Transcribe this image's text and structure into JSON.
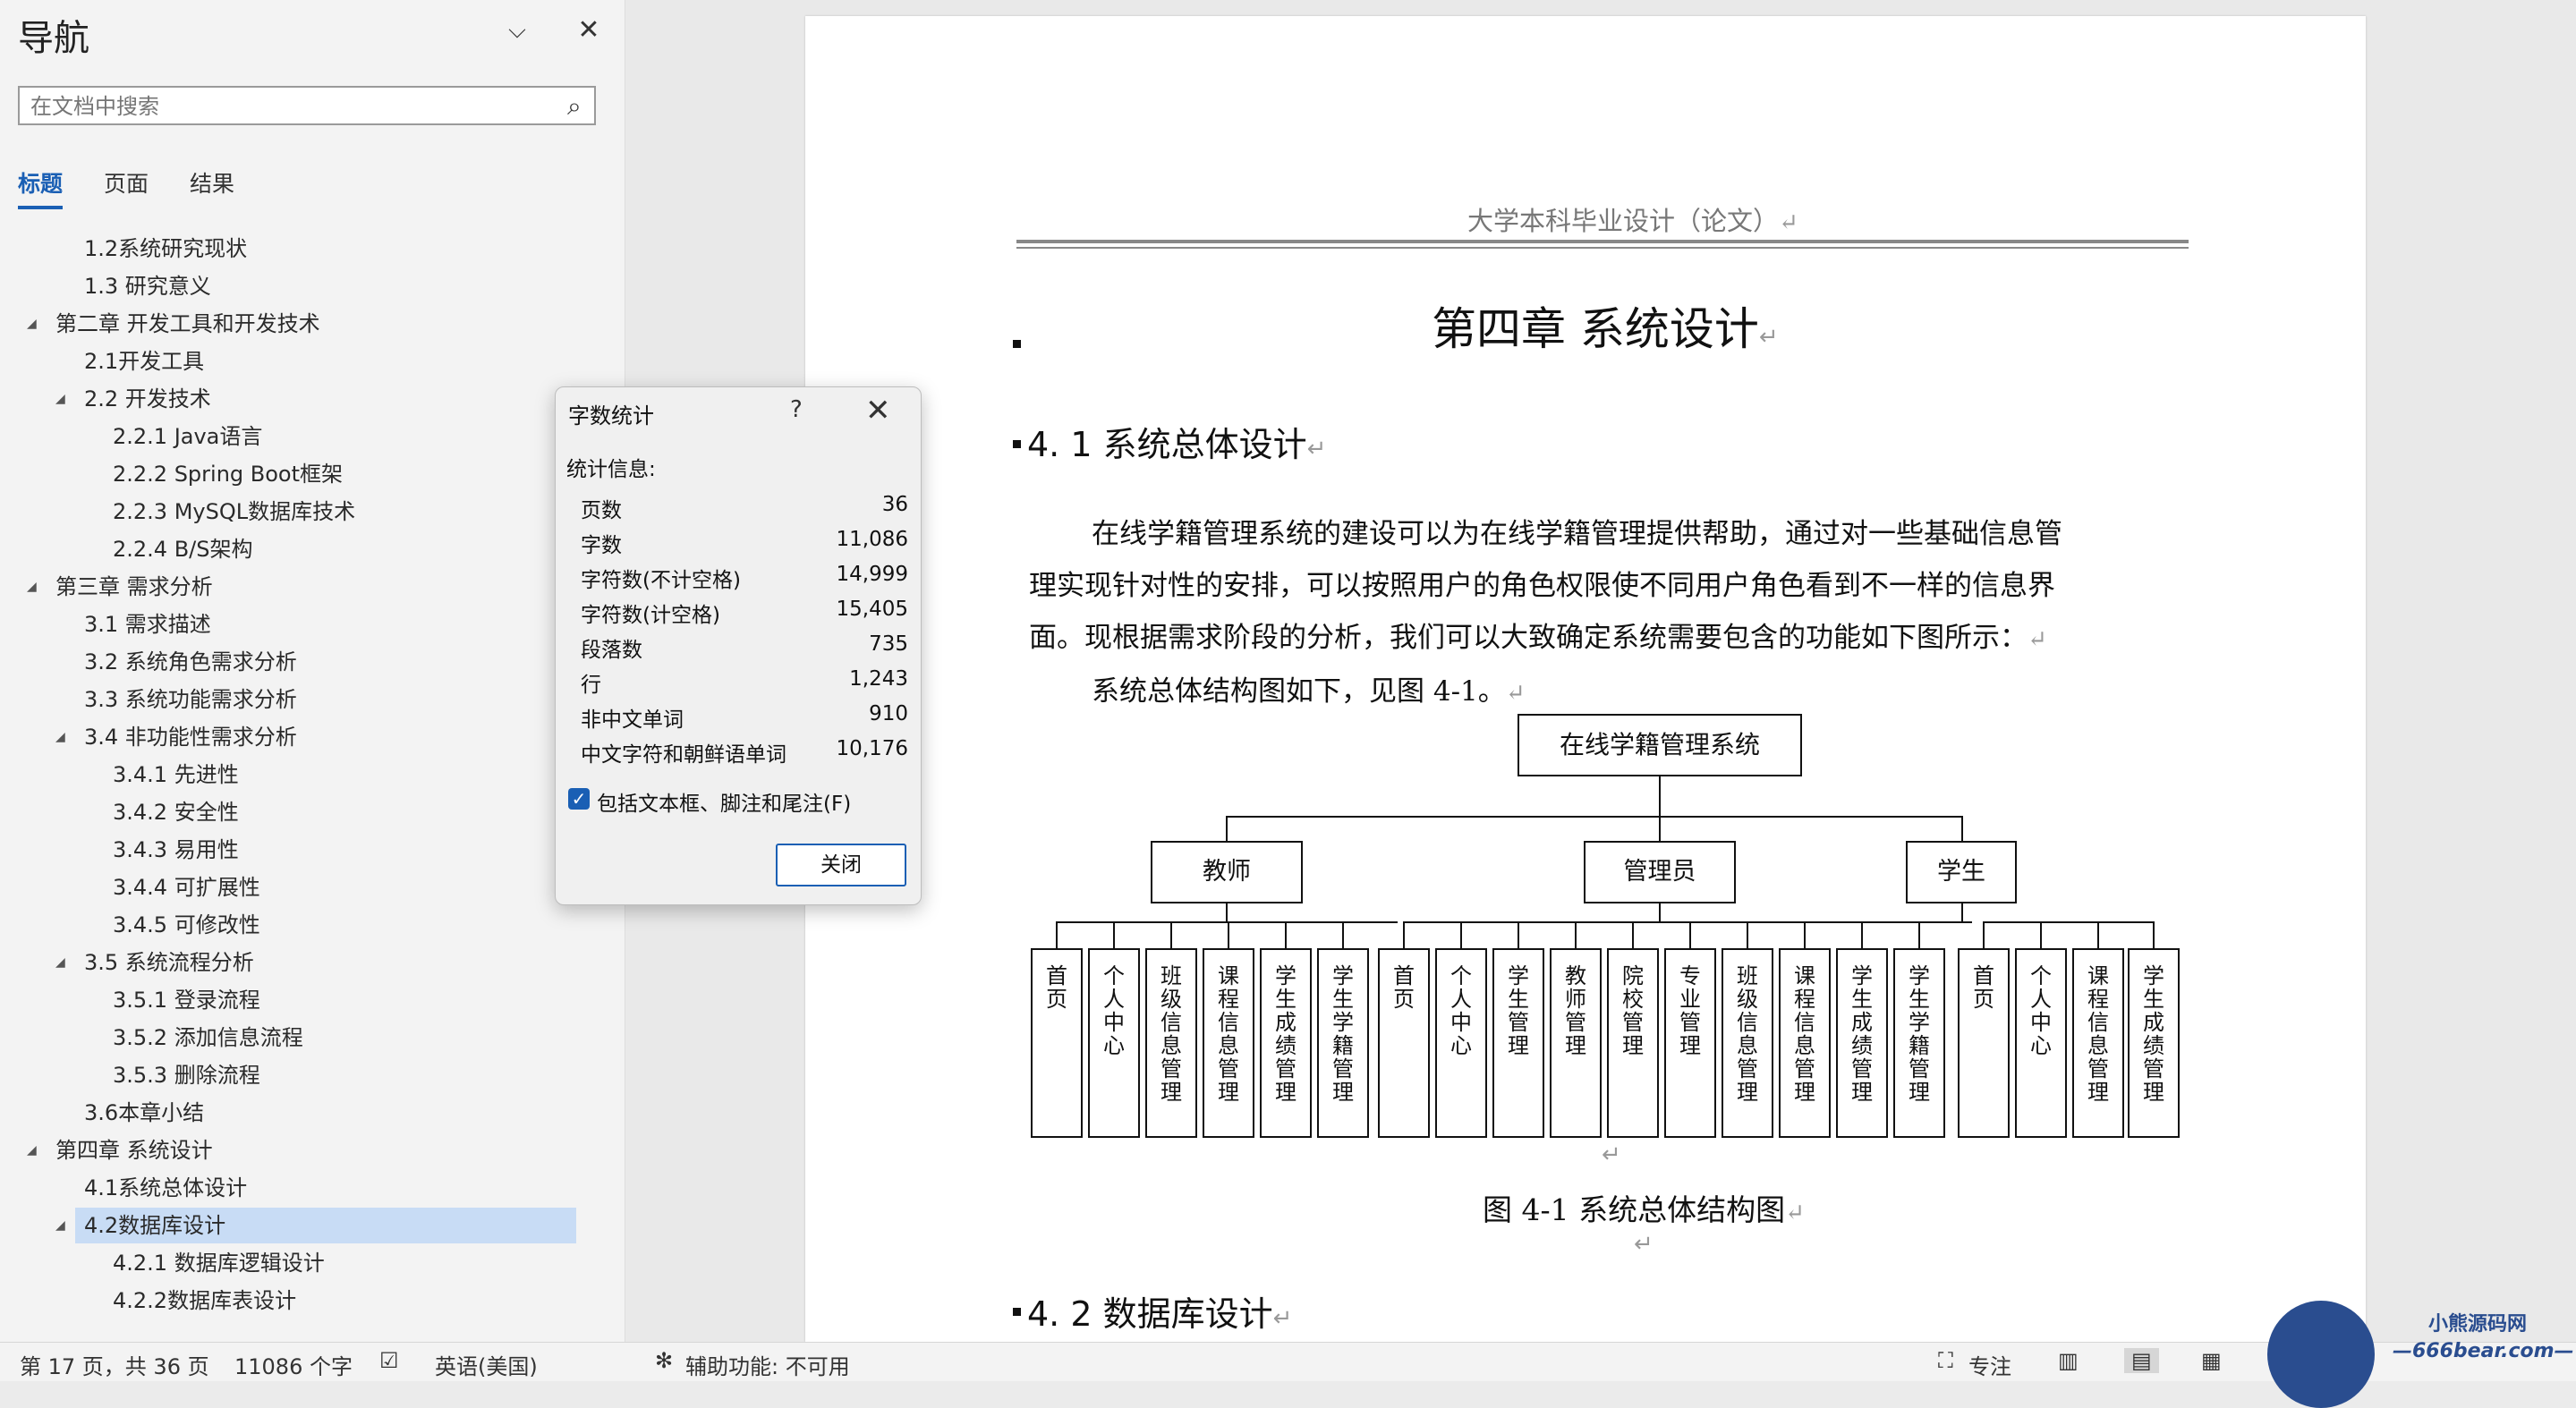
{
  "nav": {
    "title": "导航",
    "search_placeholder": "在文档中搜索",
    "tabs": [
      "标题",
      "页面",
      "结果"
    ],
    "items": [
      "1.2系统研究现状",
      "1.3 研究意义",
      "第二章 开发工具和开发技术",
      "2.1开发工具",
      "2.2 开发技术",
      "2.2.1 Java语言",
      "2.2.2 Spring Boot框架",
      "2.2.3 MySQL数据库技术",
      "2.2.4 B/S架构",
      "第三章 需求分析",
      "3.1 需求描述",
      "3.2 系统角色需求分析",
      "3.3 系统功能需求分析",
      "3.4 非功能性需求分析",
      "3.4.1 先进性",
      "3.4.2 安全性",
      "3.4.3 易用性",
      "3.4.4 可扩展性",
      "3.4.5 可修改性",
      "3.5 系统流程分析",
      "3.5.1 登录流程",
      "3.5.2 添加信息流程",
      "3.5.3 删除流程",
      "3.6本章小结",
      "第四章 系统设计",
      "4.1系统总体设计",
      "4.2数据库设计",
      "4.2.1 数据库逻辑设计",
      "4.2.2数据库表设计"
    ]
  },
  "document": {
    "header": "大学本科毕业设计（论文）",
    "chapter_title": "第四章  系统设计",
    "section1": "4. 1 系统总体设计",
    "para1_lines": [
      "在线学籍管理系统的建设可以为在线学籍管理提供帮助，通过对一些基础信息管",
      "理实现针对性的安排，可以按照用户的角色权限使不同用户角色看到不一样的信息界",
      "面。现根据需求阶段的分析，我们可以大致确定系统需要包含的功能如下图所示："
    ],
    "para2": "系统总体结构图如下，见图 4-1。",
    "return_mark": "↵",
    "caption": "图 4-1 系统总体结构图",
    "section2": "4. 2 数据库设计",
    "diagram": {
      "root": "在线学籍管理系统",
      "groups": [
        {
          "name": "教师",
          "leaves": [
            "首页",
            "个人中心",
            "班级信息管理",
            "课程信息管理",
            "学生成绩管理",
            "学生学籍管理"
          ]
        },
        {
          "name": "管理员",
          "leaves": [
            "首页",
            "个人中心",
            "学生管理",
            "教师管理",
            "院校管理",
            "专业管理",
            "班级信息管理",
            "课程信息管理",
            "学生成绩管理",
            "学生学籍管理"
          ]
        },
        {
          "name": "学生",
          "leaves": [
            "首页",
            "个人中心",
            "课程信息管理",
            "学生成绩管理"
          ]
        }
      ]
    }
  },
  "dialog": {
    "title": "字数统计",
    "help": "?",
    "section": "统计信息:",
    "rows": [
      {
        "label": "页数",
        "value": "36"
      },
      {
        "label": "字数",
        "value": "11,086"
      },
      {
        "label": "字符数(不计空格)",
        "value": "14,999"
      },
      {
        "label": "字符数(计空格)",
        "value": "15,405"
      },
      {
        "label": "段落数",
        "value": "735"
      },
      {
        "label": "行",
        "value": "1,243"
      },
      {
        "label": "非中文单词",
        "value": "910"
      },
      {
        "label": "中文字符和朝鲜语单词",
        "value": "10,176"
      }
    ],
    "checkbox_label": "包括文本框、脚注和尾注(F)",
    "close_button": "关闭"
  },
  "statusbar": {
    "page": "第 17 页，共 36 页",
    "words": "11086 个字",
    "language": "英语(美国)",
    "accessibility": "辅助功能: 不可用",
    "focus": "专注"
  },
  "watermark": {
    "line1": "小熊源码网",
    "line2": "—666bear.com—"
  }
}
